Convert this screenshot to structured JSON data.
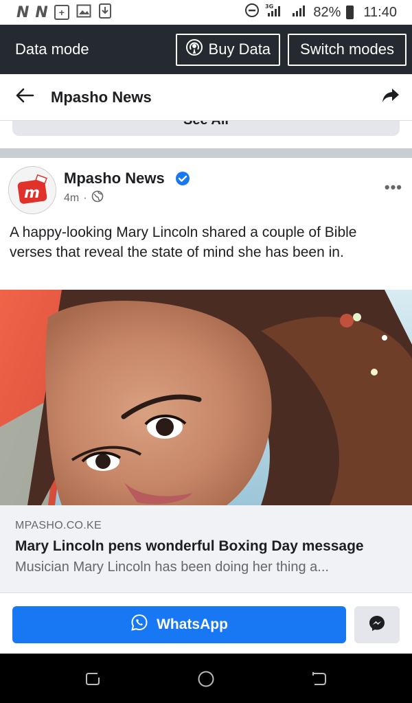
{
  "status_bar": {
    "left_icons": [
      "n-notification-icon",
      "n-notification-icon",
      "plus-icon",
      "image-icon",
      "download-icon"
    ],
    "battery": "82%",
    "time": "11:40"
  },
  "data_mode_bar": {
    "label": "Data mode",
    "buy_data_label": "Buy Data",
    "switch_modes_label": "Switch modes"
  },
  "header": {
    "title": "Mpasho News"
  },
  "see_all_label": "See All",
  "post": {
    "page_name": "Mpasho News",
    "time": "4m",
    "visibility_icon": "globe-icon",
    "text": "A happy-looking Mary Lincoln shared a couple of Bible verses that reveal the state of mind she has been in.",
    "link": {
      "domain": "MPASHO.CO.KE",
      "title": "Mary Lincoln pens wonderful Boxing Day message",
      "description": "Musician Mary Lincoln has been doing her thing a..."
    }
  },
  "actions": {
    "whatsapp_label": "WhatsApp"
  },
  "colors": {
    "brand_blue": "#1877f2",
    "data_bar_bg": "#252a30",
    "avatar_red": "#e0322b"
  }
}
